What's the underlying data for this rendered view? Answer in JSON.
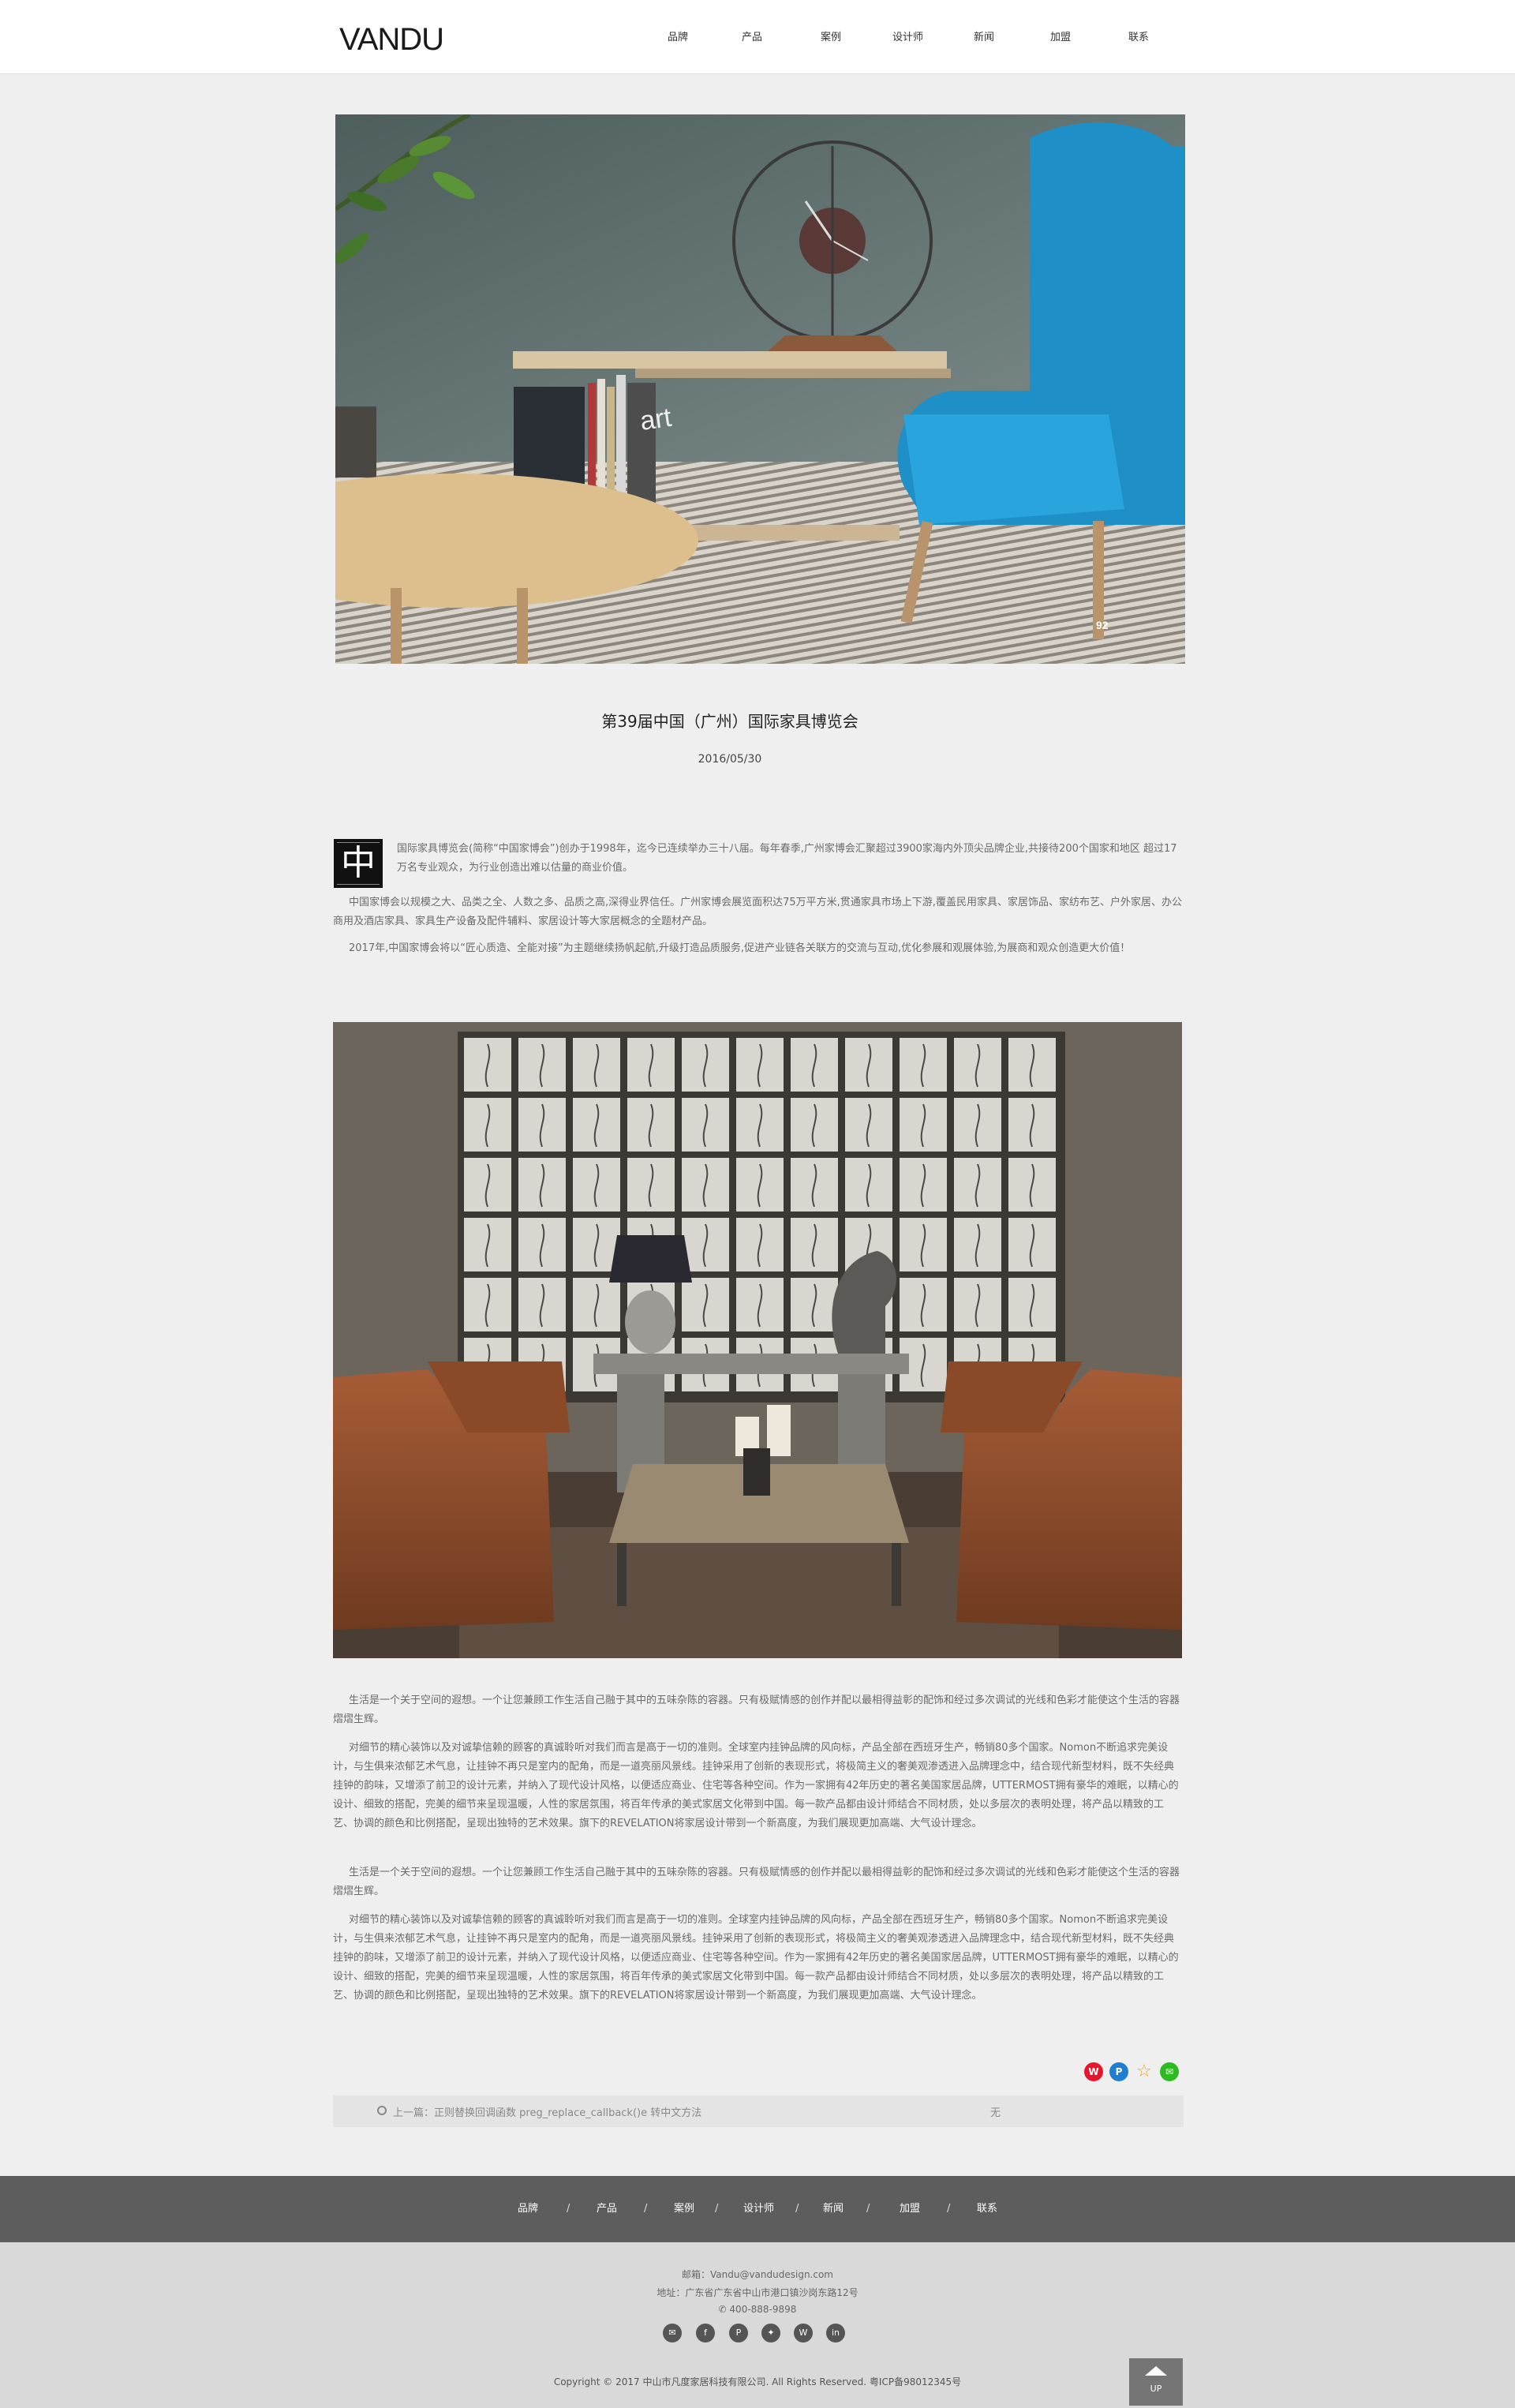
{
  "header": {
    "logo": "VANDU",
    "nav": [
      "品牌",
      "产品",
      "案例",
      "设计师",
      "新闻",
      "加盟",
      "联系"
    ]
  },
  "article": {
    "title": "第39届中国（广州）国际家具博览会",
    "date": "2016/05/30",
    "hero_badge": "92",
    "dropcap": "中",
    "intro": [
      "国际家具博览会(简称“中国家博会”)创办于1998年，迄今已连续举办三十八届。每年春季,广州家博会汇聚超过3900家海内外顶尖品牌企业,共接待200个国家和地区 超过17万名专业观众，为行业创造出难以估量的商业价值。",
      "中国家博会以规模之大、品类之全、人数之多、品质之高,深得业界信任。广州家博会展览面积达75万平方米,贯通家具市场上下游,覆盖民用家具、家居饰品、家纺布艺、户外家居、办公商用及酒店家具、家具生产设备及配件辅料、家居设计等大家居概念的全题材产品。",
      "2017年,中国家博会将以“匠心质造、全能对接”为主题继续扬帆起航,升级打造品质服务,促进产业链各关联方的交流与互动,优化参展和观展体验,为展商和观众创造更大价值！"
    ],
    "body": [
      "生活是一个关于空间的遐想。一个让您兼顾工作生活自己融于其中的五味杂陈的容器。只有极赋情感的创作并配以最相得益彰的配饰和经过多次调试的光线和色彩才能使这个生活的容器熠熠生辉。",
      "对细节的精心装饰以及对诚挚信赖的顾客的真诚聆听对我们而言是高于一切的准则。全球室内挂钟品牌的风向标，产品全部在西班牙生产，畅销80多个国家。Nomon不断追求完美设计，与生俱来浓郁艺术气息，让挂钟不再只是室内的配角，而是一道亮丽风景线。挂钟采用了创新的表现形式，将极简主义的奢美观渗透进入品牌理念中，结合现代新型材料，既不失经典挂钟的韵味，又增添了前卫的设计元素，并纳入了现代设计风格，以便适应商业、住宅等各种空间。作为一家拥有42年历史的著名美国家居品牌，UTTERMOST拥有豪华的难眠，以精心的设计、细致的搭配，完美的细节来呈现温暖，人性的家居氛围，将百年传承的美式家居文化带到中国。每一款产品都由设计师结合不同材质，处以多层次的表明处理，将产品以精致的工艺、协调的颜色和比例搭配，呈现出独特的艺术效果。旗下的REVELATION将家居设计带到一个新高度，为我们展现更加高端、大气设计理念。",
      "生活是一个关于空间的遐想。一个让您兼顾工作生活自己融于其中的五味杂陈的容器。只有极赋情感的创作并配以最相得益彰的配饰和经过多次调试的光线和色彩才能使这个生活的容器熠熠生辉。",
      "对细节的精心装饰以及对诚挚信赖的顾客的真诚聆听对我们而言是高于一切的准则。全球室内挂钟品牌的风向标，产品全部在西班牙生产，畅销80多个国家。Nomon不断追求完美设计，与生俱来浓郁艺术气息，让挂钟不再只是室内的配角，而是一道亮丽风景线。挂钟采用了创新的表现形式，将极简主义的奢美观渗透进入品牌理念中，结合现代新型材料，既不失经典挂钟的韵味，又增添了前卫的设计元素，并纳入了现代设计风格，以便适应商业、住宅等各种空间。作为一家拥有42年历史的著名美国家居品牌，UTTERMOST拥有豪华的难眠，以精心的设计、细致的搭配，完美的细节来呈现温暖，人性的家居氛围，将百年传承的美式家居文化带到中国。每一款产品都由设计师结合不同材质，处以多层次的表明处理，将产品以精致的工艺、协调的颜色和比例搭配，呈现出独特的艺术效果。旗下的REVELATION将家居设计带到一个新高度，为我们展现更加高端、大气设计理念。"
    ]
  },
  "pager": {
    "prev": "上一篇：正则替换回调函数 preg_replace_callback()e 转中文方法",
    "next": "无"
  },
  "footer": {
    "nav": [
      "品牌",
      "产品",
      "案例",
      "设计师",
      "新闻",
      "加盟",
      "联系"
    ],
    "separator": "/",
    "email": "邮箱：Vandu@vandudesign.com",
    "address": "地址：广东省广东省中山市港口镇沙岗东路12号",
    "phone": "400-888-9898",
    "copyright": "Copyright © 2017 中山市凡度家居科技有限公司. All Rights Reserved.     粤ICP备98012345号",
    "up_label": "UP"
  },
  "colors": {
    "header_bg": "#ffffff",
    "page_bg": "#efefef",
    "footer_nav_bg": "#5d5d5d",
    "footer_bg": "#d9d9d9"
  }
}
